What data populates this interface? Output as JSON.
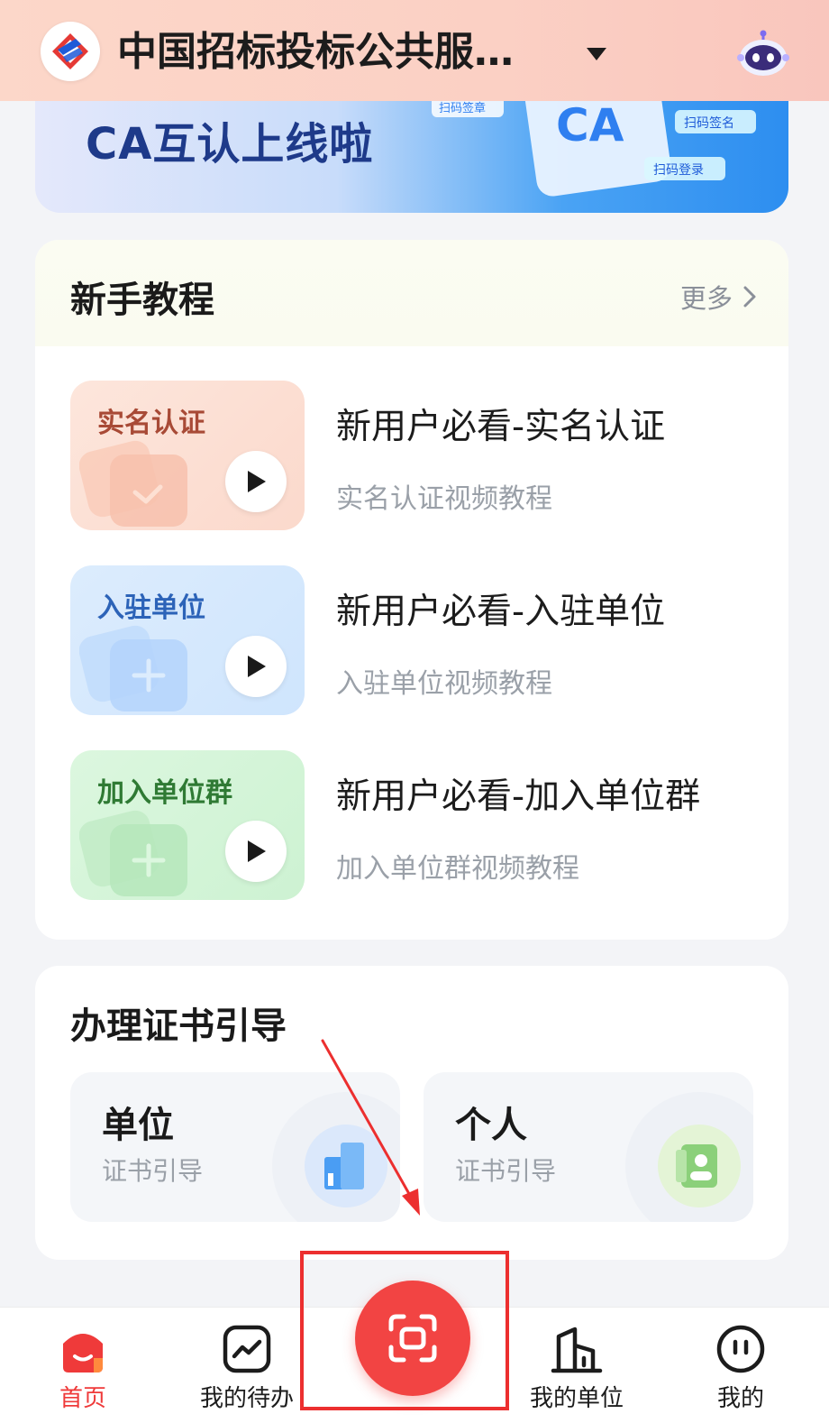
{
  "header": {
    "org_title": "中国招标投标公共服务..."
  },
  "banner": {
    "title": "CA互认上线啦",
    "tags": [
      "扫码签章",
      "扫码签名",
      "扫码登录"
    ],
    "card_text": "CA"
  },
  "tutorial": {
    "title": "新手教程",
    "more_label": "更多",
    "items": [
      {
        "thumb_label": "实名认证",
        "title": "新用户必看-实名认证",
        "subtitle": "实名认证视频教程"
      },
      {
        "thumb_label": "入驻单位",
        "title": "新用户必看-入驻单位",
        "subtitle": "入驻单位视频教程"
      },
      {
        "thumb_label": "加入单位群",
        "title": "新用户必看-加入单位群",
        "subtitle": "加入单位群视频教程"
      }
    ]
  },
  "certificate": {
    "title": "办理证书引导",
    "tiles": [
      {
        "title": "单位",
        "subtitle": "证书引导"
      },
      {
        "title": "个人",
        "subtitle": "证书引导"
      }
    ]
  },
  "tabbar": {
    "tabs": [
      {
        "label": "首页",
        "active": true
      },
      {
        "label": "我的待办",
        "active": false
      },
      {
        "label": "我的单位",
        "active": false
      },
      {
        "label": "我的",
        "active": false
      }
    ]
  },
  "colors": {
    "accent": "#ef3a3a",
    "scan_button": "#f24443",
    "header_bg": "#fbd0c4",
    "annotation": "#ec2f2f"
  }
}
